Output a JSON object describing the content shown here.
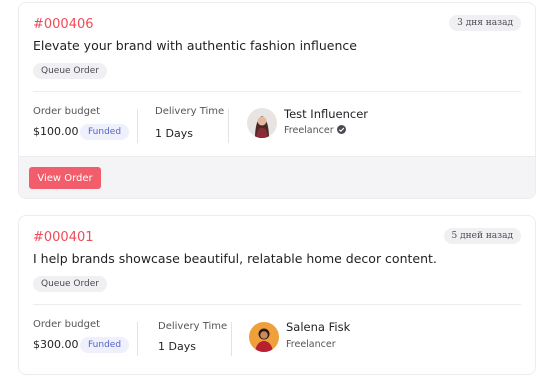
{
  "orders": [
    {
      "id": "#000406",
      "time_ago": "3 дня назад",
      "title": "Elevate your brand with authentic fashion influence",
      "tag": "Queue Order",
      "budget_label": "Order budget",
      "budget_value": "$100.00",
      "budget_status": "Funded",
      "delivery_label": "Delivery Time",
      "delivery_value": "1 Days",
      "freelancer_name": "Test Influencer",
      "freelancer_role": "Freelancer",
      "freelancer_verified": true,
      "action_label": "View Order"
    },
    {
      "id": "#000401",
      "time_ago": "5 дней назад",
      "title": "I help brands showcase beautiful, relatable home decor content.",
      "tag": "Queue Order",
      "budget_label": "Order budget",
      "budget_value": "$300.00",
      "budget_status": "Funded",
      "delivery_label": "Delivery Time",
      "delivery_value": "1 Days",
      "freelancer_name": "Salena Fisk",
      "freelancer_role": "Freelancer",
      "freelancer_verified": false
    }
  ],
  "colors": {
    "accent_red": "#ef4b58",
    "button_red": "#f25d6b",
    "funded_text": "#5a63c9",
    "funded_bg": "#eef0fb"
  }
}
